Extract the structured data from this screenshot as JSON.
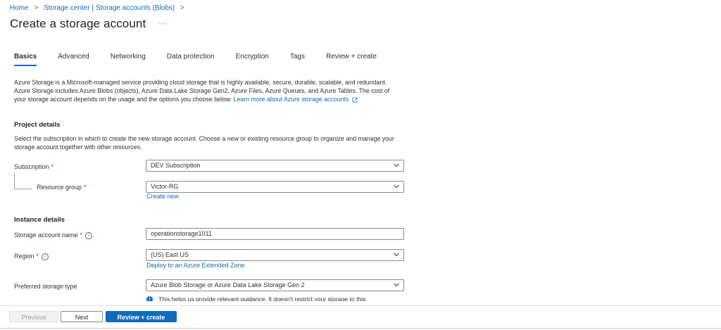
{
  "breadcrumb": {
    "home": "Home",
    "storage_center": "Storage center | Storage accounts (Blobs)",
    "separator": ">"
  },
  "page": {
    "title": "Create a storage account",
    "more": "···"
  },
  "tabs": [
    {
      "label": "Basics",
      "active": true
    },
    {
      "label": "Advanced"
    },
    {
      "label": "Networking"
    },
    {
      "label": "Data protection"
    },
    {
      "label": "Encryption"
    },
    {
      "label": "Tags"
    },
    {
      "label": "Review + create"
    }
  ],
  "intro": {
    "text": "Azure Storage is a Microsoft-managed service providing cloud storage that is highly available, secure, durable, scalable, and redundant. Azure Storage includes Azure Blobs (objects), Azure Data Lake Storage Gen2, Azure Files, Azure Queues, and Azure Tables. The cost of your storage account depends on the usage and the options you choose below.",
    "link": "Learn more about Azure storage accounts"
  },
  "project": {
    "title": "Project details",
    "description": "Select the subscription in which to create the new storage account. Choose a new or existing resource group to organize and manage your storage account together with other resources.",
    "subscription_label": "Subscription",
    "subscription_value": "DEV Subscription",
    "resource_group_label": "Resource group",
    "resource_group_value": "Victor-RG",
    "create_new": "Create new"
  },
  "instance": {
    "title": "Instance details",
    "name_label": "Storage account name",
    "name_value": "operationstorage1011",
    "region_label": "Region",
    "region_value": "(US) East US",
    "extended_zone_link": "Deploy to an Azure Extended Zone",
    "storage_type_label": "Preferred storage type",
    "storage_type_value": "Azure Blob Storage or Azure Data Lake Storage Gen 2",
    "storage_type_note": "This helps us provide relevant guidance. It doesn't restrict your storage to this"
  },
  "footer": {
    "previous": "Previous",
    "next": "Next",
    "review": "Review + create"
  },
  "required_mark": "*",
  "colors": {
    "accent": "#0f6cbd",
    "required": "#a4262c",
    "text": "#323130"
  }
}
